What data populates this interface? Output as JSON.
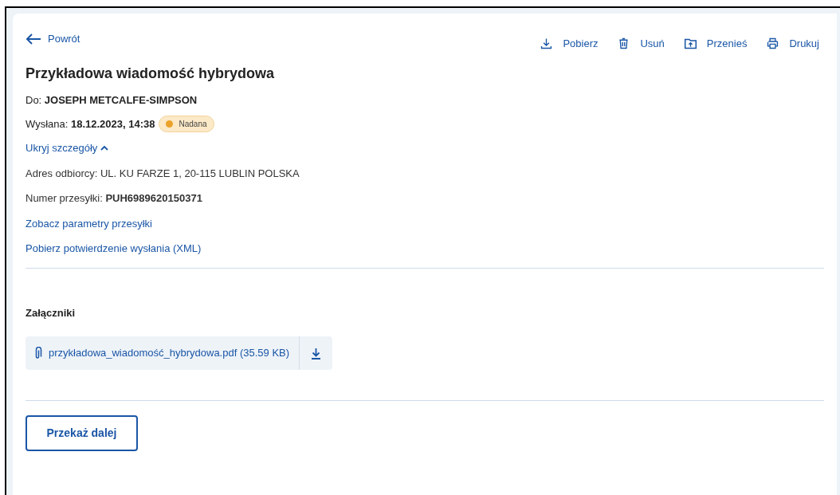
{
  "back_link": "Powrót",
  "actions": [
    {
      "kind": "download",
      "label": "Pobierz"
    },
    {
      "kind": "delete",
      "label": "Usuń"
    },
    {
      "kind": "move",
      "label": "Przenieś"
    },
    {
      "kind": "print",
      "label": "Drukuj"
    }
  ],
  "title": "Przykładowa wiadomość hybrydowa",
  "recipient": "Do:  **JOSEPH METCALFE-SIMPSON**",
  "sent": "Wysłana: **18.12.2023, 14:38**",
  "status": {
    "label": "Nadana",
    "color": "#eaa22a"
  },
  "details_toggle": {
    "label": "Ukryj szczegóły",
    "expanded": true
  },
  "details": [
    {
      "kind": "text",
      "text": "Adres odbiorcy: UL. KU FARZE 1, 20-115 LUBLIN POLSKA"
    },
    {
      "kind": "text",
      "text": "Numer przesyłki: **PUH6989620150371**"
    },
    {
      "kind": "link",
      "text": "Zobacz parametry przesyłki"
    },
    {
      "kind": "link",
      "text": "Pobierz potwierdzenie wysłania (XML)"
    }
  ],
  "attachments_heading": "Załączniki",
  "attachments": [
    {
      "name": "przykładowa_wiadomość_hybrydowa.pdf (35.59 KB)"
    }
  ],
  "forward_button": "Przekaż dalej"
}
